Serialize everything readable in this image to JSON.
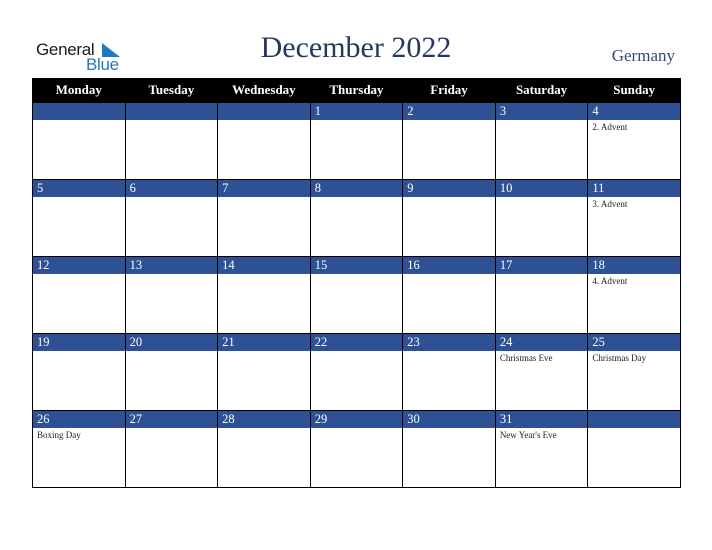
{
  "logo": {
    "part1": "General",
    "part2": "Blue",
    "icon": "triangle-logo-icon",
    "accent_color": "#1f7ac2"
  },
  "header": {
    "title": "December 2022",
    "country": "Germany"
  },
  "colors": {
    "day_bar": "#2d5194",
    "header_bg": "#000000",
    "title": "#24395f"
  },
  "weekdays": [
    "Monday",
    "Tuesday",
    "Wednesday",
    "Thursday",
    "Friday",
    "Saturday",
    "Sunday"
  ],
  "weeks": [
    [
      {
        "day": "",
        "event": ""
      },
      {
        "day": "",
        "event": ""
      },
      {
        "day": "",
        "event": ""
      },
      {
        "day": "1",
        "event": ""
      },
      {
        "day": "2",
        "event": ""
      },
      {
        "day": "3",
        "event": ""
      },
      {
        "day": "4",
        "event": "2. Advent"
      }
    ],
    [
      {
        "day": "5",
        "event": ""
      },
      {
        "day": "6",
        "event": ""
      },
      {
        "day": "7",
        "event": ""
      },
      {
        "day": "8",
        "event": ""
      },
      {
        "day": "9",
        "event": ""
      },
      {
        "day": "10",
        "event": ""
      },
      {
        "day": "11",
        "event": "3. Advent"
      }
    ],
    [
      {
        "day": "12",
        "event": ""
      },
      {
        "day": "13",
        "event": ""
      },
      {
        "day": "14",
        "event": ""
      },
      {
        "day": "15",
        "event": ""
      },
      {
        "day": "16",
        "event": ""
      },
      {
        "day": "17",
        "event": ""
      },
      {
        "day": "18",
        "event": "4. Advent"
      }
    ],
    [
      {
        "day": "19",
        "event": ""
      },
      {
        "day": "20",
        "event": ""
      },
      {
        "day": "21",
        "event": ""
      },
      {
        "day": "22",
        "event": ""
      },
      {
        "day": "23",
        "event": ""
      },
      {
        "day": "24",
        "event": "Christmas Eve"
      },
      {
        "day": "25",
        "event": "Christmas Day"
      }
    ],
    [
      {
        "day": "26",
        "event": "Boxing Day"
      },
      {
        "day": "27",
        "event": ""
      },
      {
        "day": "28",
        "event": ""
      },
      {
        "day": "29",
        "event": ""
      },
      {
        "day": "30",
        "event": ""
      },
      {
        "day": "31",
        "event": "New Year's Eve"
      },
      {
        "day": "",
        "event": ""
      }
    ]
  ]
}
